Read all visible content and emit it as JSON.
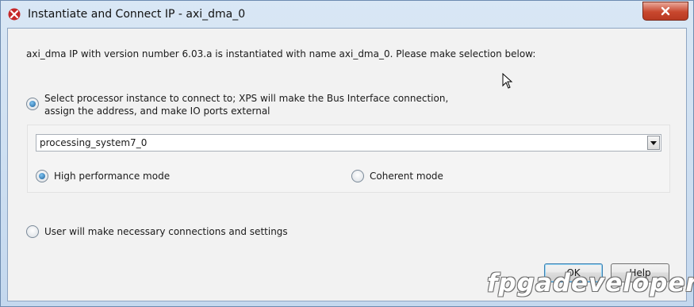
{
  "window": {
    "title": "Instantiate and Connect IP - axi_dma_0",
    "app_icon": "xilinx-logo-icon",
    "close_icon": "close-icon"
  },
  "info_text": "axi_dma IP with version number 6.03.a is instantiated with name axi_dma_0. Please make selection below:",
  "options": {
    "processor": {
      "line1": "Select processor instance to connect to; XPS will make the Bus Interface connection,",
      "line2": "assign the address, and make IO ports external",
      "selected": true
    },
    "processor_select_value": "processing_system7_0",
    "high_performance": {
      "label": "High performance mode",
      "selected": true
    },
    "coherent": {
      "label": "Coherent mode",
      "selected": false
    },
    "user_manual": {
      "label": "User will make necessary connections and settings",
      "selected": false
    }
  },
  "buttons": {
    "ok": "OK",
    "help": "Help"
  },
  "watermark": "fpgadeveloper",
  "colors": {
    "close_button": "#c8472e",
    "radio_selected": "#1c5f99",
    "default_button_border": "#3c7fb1"
  }
}
